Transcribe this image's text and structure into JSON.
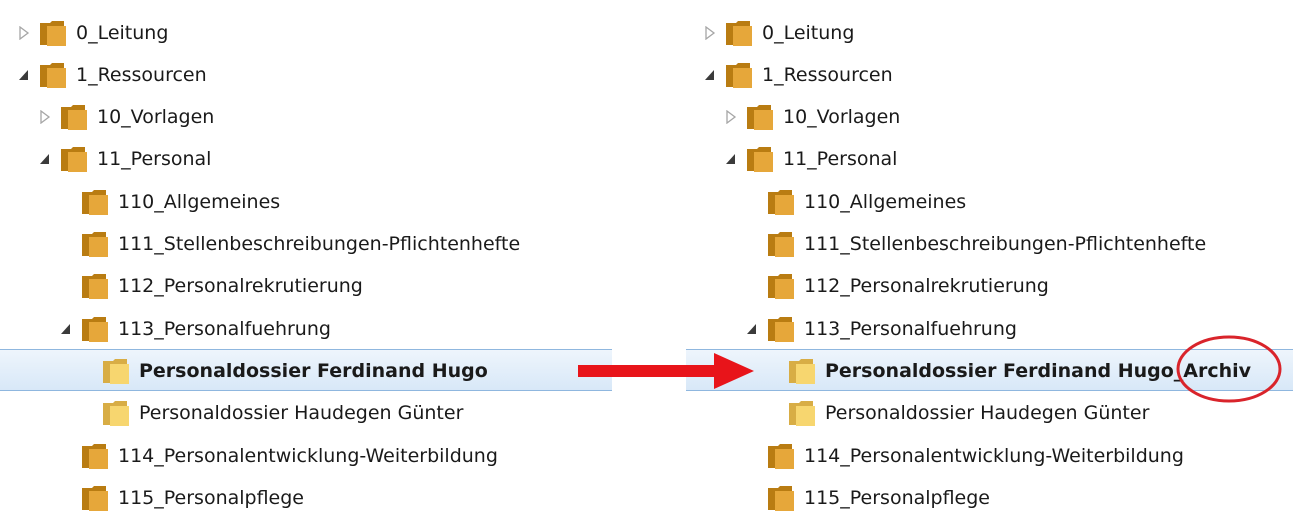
{
  "left_tree": {
    "items": [
      {
        "label": "0_Leitung",
        "depth": 0,
        "toggle": "collapsed",
        "folder": "dark",
        "selected": false
      },
      {
        "label": "1_Ressourcen",
        "depth": 0,
        "toggle": "expanded",
        "folder": "dark",
        "selected": false
      },
      {
        "label": "10_Vorlagen",
        "depth": 1,
        "toggle": "collapsed",
        "folder": "dark",
        "selected": false
      },
      {
        "label": "11_Personal",
        "depth": 1,
        "toggle": "expanded",
        "folder": "dark",
        "selected": false
      },
      {
        "label": "110_Allgemeines",
        "depth": 2,
        "toggle": "none",
        "folder": "dark",
        "selected": false
      },
      {
        "label": "111_Stellenbeschreibungen-Pflichtenhefte",
        "depth": 2,
        "toggle": "none",
        "folder": "dark",
        "selected": false
      },
      {
        "label": "112_Personalrekrutierung",
        "depth": 2,
        "toggle": "none",
        "folder": "dark",
        "selected": false
      },
      {
        "label": "113_Personalfuehrung",
        "depth": 2,
        "toggle": "expanded",
        "folder": "dark",
        "selected": false
      },
      {
        "label": "Personaldossier Ferdinand Hugo",
        "depth": 3,
        "toggle": "none",
        "folder": "light",
        "selected": true
      },
      {
        "label": "Personaldossier Haudegen Günter",
        "depth": 3,
        "toggle": "none",
        "folder": "light",
        "selected": false
      },
      {
        "label": "114_Personalentwicklung-Weiterbildung",
        "depth": 2,
        "toggle": "none",
        "folder": "dark",
        "selected": false
      },
      {
        "label": "115_Personalpflege",
        "depth": 2,
        "toggle": "none",
        "folder": "dark",
        "selected": false
      }
    ]
  },
  "right_tree": {
    "items": [
      {
        "label": "0_Leitung",
        "depth": 0,
        "toggle": "collapsed",
        "folder": "dark",
        "selected": false
      },
      {
        "label": "1_Ressourcen",
        "depth": 0,
        "toggle": "expanded",
        "folder": "dark",
        "selected": false
      },
      {
        "label": "10_Vorlagen",
        "depth": 1,
        "toggle": "collapsed",
        "folder": "dark",
        "selected": false
      },
      {
        "label": "11_Personal",
        "depth": 1,
        "toggle": "expanded",
        "folder": "dark",
        "selected": false
      },
      {
        "label": "110_Allgemeines",
        "depth": 2,
        "toggle": "none",
        "folder": "dark",
        "selected": false
      },
      {
        "label": "111_Stellenbeschreibungen-Pflichtenhefte",
        "depth": 2,
        "toggle": "none",
        "folder": "dark",
        "selected": false
      },
      {
        "label": "112_Personalrekrutierung",
        "depth": 2,
        "toggle": "none",
        "folder": "dark",
        "selected": false
      },
      {
        "label": "113_Personalfuehrung",
        "depth": 2,
        "toggle": "expanded",
        "folder": "dark",
        "selected": false
      },
      {
        "label": "Personaldossier Ferdinand Hugo_Archiv",
        "depth": 3,
        "toggle": "none",
        "folder": "light",
        "selected": true
      },
      {
        "label": "Personaldossier Haudegen Günter",
        "depth": 3,
        "toggle": "none",
        "folder": "light",
        "selected": false
      },
      {
        "label": "114_Personalentwicklung-Weiterbildung",
        "depth": 2,
        "toggle": "none",
        "folder": "dark",
        "selected": false
      },
      {
        "label": "115_Personalpflege",
        "depth": 2,
        "toggle": "none",
        "folder": "dark",
        "selected": false
      }
    ]
  },
  "annotation": {
    "arrow_color": "#e8141a",
    "circle_color": "#d9242b",
    "arrow_icon": "right-arrow-icon",
    "highlight_icon": "highlight-circle-icon"
  },
  "colors": {
    "folder_dark_back": "#b97c12",
    "folder_dark_front": "#e6a73a",
    "folder_light_back": "#d8ad45",
    "folder_light_front": "#f7d66f",
    "selection_border": "#8fb7df"
  }
}
